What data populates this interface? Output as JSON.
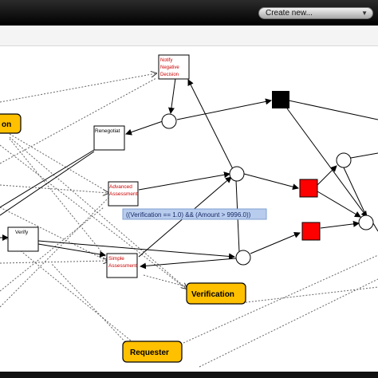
{
  "toolbar": {
    "create_label": "Create new...",
    "dropdown_icon": "chevron-down-icon"
  },
  "tasks": {
    "notify": [
      "Notify",
      "Negative",
      "Decision"
    ],
    "renegotiate": "Renegotiat",
    "advanced": [
      "Advanced",
      "Assessment"
    ],
    "verify": "Verify",
    "simple": [
      "Simple",
      "Assessment"
    ]
  },
  "roles": {
    "partial": "on",
    "verification": "Verification",
    "requester": "Requester"
  },
  "guard_label": "((Verification == 1.0) && (Amount > 9996.0))",
  "colors": {
    "task_text_red": "#cc0000",
    "role_fill": "#ffc000",
    "gateway_red": "#ff0000",
    "gateway_black": "#000000",
    "guard_bg": "#b8ccee"
  }
}
